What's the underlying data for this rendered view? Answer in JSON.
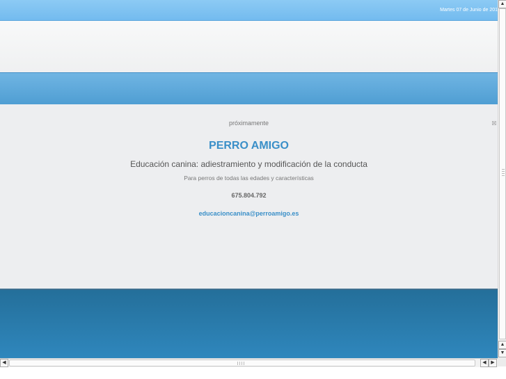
{
  "topbar": {
    "date": "Martes 07 de Junio de 201"
  },
  "content": {
    "notice": "próximamente",
    "site_title": "PERRO AMIGO",
    "subtitle": "Educación canina: adiestramiento y modificación de la conducta",
    "tagline": "Para perros de todas las edades y características",
    "phone": "675.804.792",
    "email": "educacioncanina@perroamigo.es"
  },
  "colors": {
    "accent": "#3a8fc8",
    "topbar": "#7fc3f2",
    "nav": "#5aa6da",
    "footer": "#2b7fb2",
    "content_bg": "#edeef0"
  },
  "icons": {
    "close": "close-icon",
    "scroll_up": "arrow-up-icon",
    "scroll_down": "arrow-down-icon",
    "scroll_left": "arrow-left-icon",
    "scroll_right": "arrow-right-icon"
  }
}
